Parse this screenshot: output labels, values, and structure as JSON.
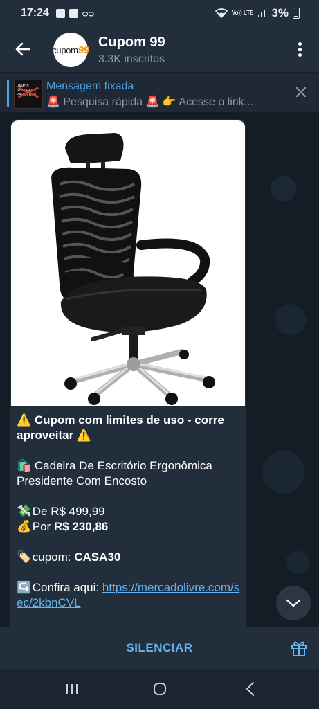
{
  "status_bar": {
    "time": "17:24",
    "network_label": "Vo)) LTE",
    "battery": "3%"
  },
  "header": {
    "channel_name": "Cupom 99",
    "subscribers": "3.3K inscritos",
    "avatar_text": "cupom",
    "avatar_accent": "99"
  },
  "pinned": {
    "title": "Mensagem fixada",
    "preview": "🚨 Pesquisa rápida 🚨   👉 Acesse o link...",
    "thumb_text": "VAMOS SHOPPAR PARA VOCÊ!"
  },
  "message": {
    "line1": "⚠️ Cupom com limites de uso - corre aproveitar ⚠️",
    "product": "🛍️ Cadeira De Escritório Ergonômica Presidente Com Encosto",
    "price_from_label": "De R$ 499,99",
    "price_from_emoji": "💸",
    "price_to_label": "Por ",
    "price_to_value": "R$ 230,86",
    "price_to_emoji": "💰",
    "coupon_label": "cupom: ",
    "coupon_code": "CASA30",
    "coupon_emoji": "🏷️",
    "link_label": "Confira aqui:  ",
    "link_emoji": "↪️",
    "link_url": "https://mercadolivre.com/sec/2kbnCVL"
  },
  "bottom_bar": {
    "mute_label": "SILENCIAR"
  },
  "colors": {
    "accent": "#62b3f0",
    "bubble": "#232e3c",
    "header": "#232e3c",
    "chat_bg": "#141c26"
  }
}
